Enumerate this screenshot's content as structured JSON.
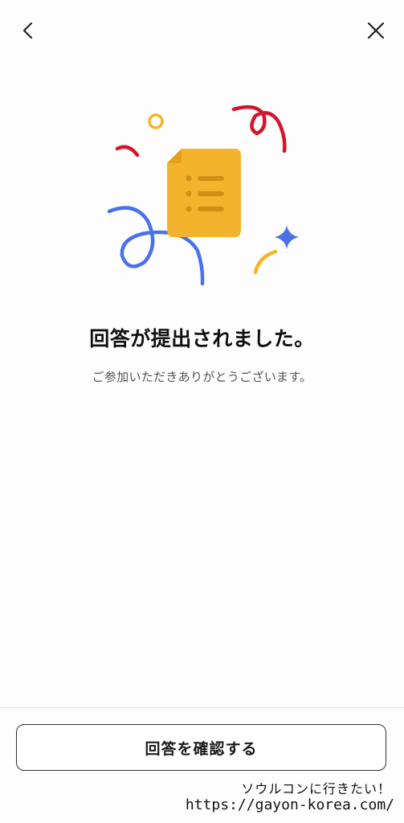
{
  "nav": {
    "back_icon": "chevron-left-icon",
    "close_icon": "close-icon"
  },
  "illustration": {
    "document_icon": "document-list-icon",
    "colors": {
      "document": "#F4B32D",
      "document_lines": "#D18F14",
      "blue": "#4A72E8",
      "red": "#D2162E",
      "yellow": "#F3B52C"
    }
  },
  "content": {
    "title": "回答が提出されました。",
    "subtitle": "ご参加いただきありがとうございます。"
  },
  "footer": {
    "confirm_label": "回答を確認する"
  },
  "watermark": {
    "line1": "ソウルコンに行きたい！",
    "line2": "https://gayon-korea.com/"
  }
}
